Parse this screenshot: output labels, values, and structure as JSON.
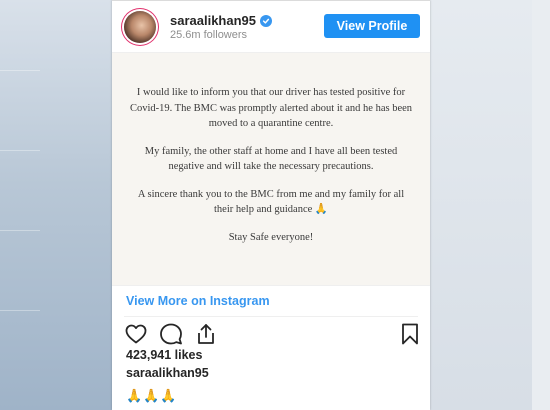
{
  "post": {
    "username": "saraalikhan95",
    "followers": "25.6m followers",
    "view_profile_label": "View Profile",
    "note": {
      "paragraph1": "I would like to inform you that our driver has tested positive for Covid-19. The BMC was promptly alerted about it and he has been moved to a quarantine centre.",
      "paragraph2": "My family, the other staff at home and I have all been tested negative and will take the necessary precautions.",
      "paragraph3": "A sincere thank you to the BMC from me and my family for all their help and guidance 🙏",
      "paragraph4": "Stay Safe everyone!"
    },
    "view_more_label": "View More on Instagram",
    "likes": "423,941 likes",
    "caption_username": "saraalikhan95",
    "caption_text": "🙏🙏🙏"
  },
  "icons": {
    "verified": "verified-badge-icon",
    "like": "heart-icon",
    "comment": "comment-icon",
    "share": "share-icon",
    "save": "bookmark-icon"
  },
  "colors": {
    "accent": "#1f91f3",
    "link": "#3897f0",
    "text": "#262626",
    "muted": "#8e8e8e",
    "note_bg": "#f7f5f1"
  }
}
